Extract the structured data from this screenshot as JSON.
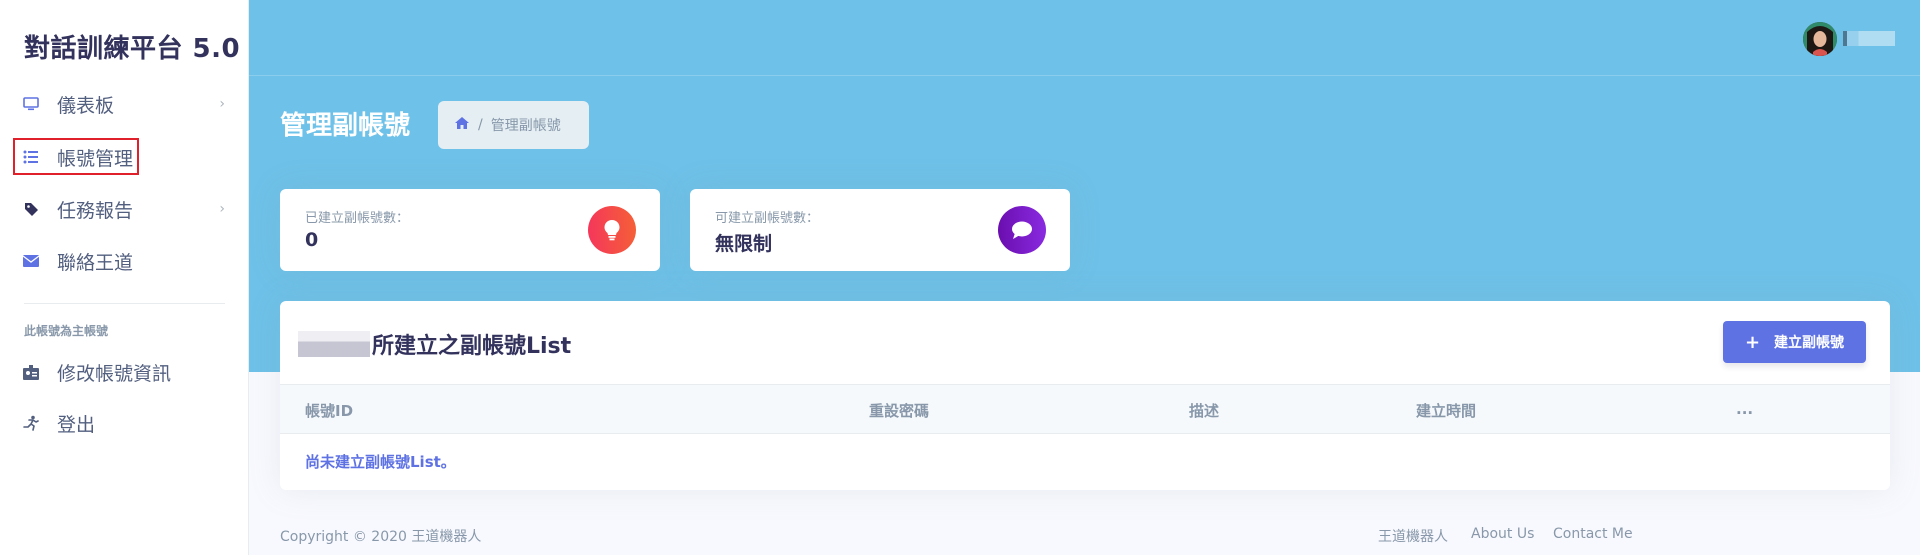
{
  "brand": "對話訓練平台 5.0",
  "sidebar": {
    "items": [
      {
        "label": "儀表板",
        "icon": "monitor-icon"
      },
      {
        "label": "帳號管理",
        "icon": "list-icon"
      },
      {
        "label": "任務報告",
        "icon": "tag-icon"
      },
      {
        "label": "聯絡王道",
        "icon": "envelope-icon"
      }
    ],
    "heading": "此帳號為主帳號",
    "bottom_items": [
      {
        "label": "修改帳號資訊",
        "icon": "id-card-icon"
      },
      {
        "label": "登出",
        "icon": "running-icon"
      }
    ]
  },
  "header": {
    "title": "管理副帳號",
    "breadcrumb_current": "管理副帳號",
    "breadcrumb_sep": "/"
  },
  "stats": [
    {
      "label": "已建立副帳號數：",
      "value": "0",
      "color": "#f5365c",
      "icon": "lightbulb-icon"
    },
    {
      "label": "可建立副帳號數：",
      "value": "無限制",
      "color": "#8965e0",
      "icon": "chat-bubble-icon"
    }
  ],
  "table": {
    "title": "所建立之副帳號List",
    "add_button": "建立副帳號",
    "columns": [
      "帳號ID",
      "重設密碼",
      "描述",
      "建立時間",
      "..."
    ],
    "empty_message": "尚未建立副帳號List。"
  },
  "footer": {
    "copyright": "Copyright © 2020 王道機器人",
    "links": [
      "王道機器人",
      "About Us",
      "Contact Me"
    ]
  },
  "colors": {
    "header_bg": "#6ec1e8",
    "accent": "#5e72e4",
    "active_outline": "#e0202a"
  }
}
